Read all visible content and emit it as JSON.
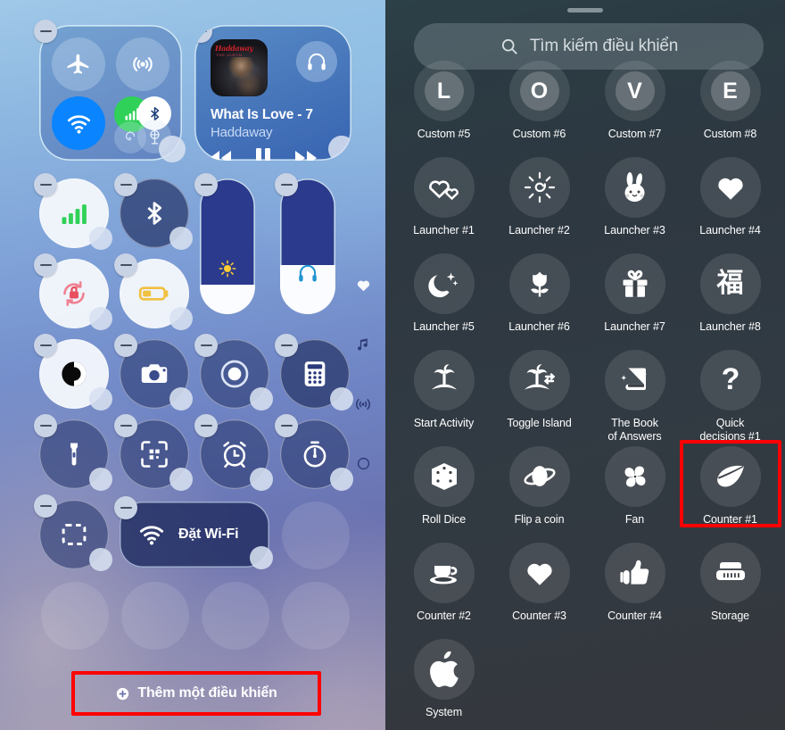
{
  "left_panel": {
    "name": "control-center-edit-mode",
    "connectivity_group": {
      "controls": [
        {
          "name": "airplane-mode",
          "icon": "airplane-icon",
          "state": "off"
        },
        {
          "name": "airdrop",
          "icon": "airdrop-icon",
          "state": "off"
        },
        {
          "name": "wifi",
          "icon": "wifi-icon",
          "state": "on",
          "color": "#0a84ff"
        },
        {
          "name": "cellular-data",
          "icon": "cellular-icon",
          "state": "on",
          "color": "#30d158"
        },
        {
          "name": "bluetooth",
          "icon": "bluetooth-icon",
          "state": "on",
          "color": "#ffffff"
        },
        {
          "name": "personal-hotspot",
          "icon": "hotspot-icon",
          "state": "off"
        },
        {
          "name": "vpn",
          "icon": "vpn-icon",
          "state": "off"
        }
      ]
    },
    "media_player": {
      "track_title": "What Is Love - 7",
      "artist": "Haddaway",
      "album_art_text": "Haddaway",
      "album_art_subtext": "THE ALBUM",
      "buttons": [
        "rewind",
        "pause",
        "fast-forward"
      ],
      "output_icon": "headphones-icon"
    },
    "tiles": [
      {
        "name": "cellular-signal",
        "icon": "signal-bars-icon",
        "style": "light"
      },
      {
        "name": "bluetooth-toggle",
        "icon": "bluetooth-icon",
        "style": "dark"
      },
      {
        "name": "rotation-lock",
        "icon": "rotation-lock-icon",
        "style": "light"
      },
      {
        "name": "low-power-mode",
        "icon": "battery-icon",
        "style": "light"
      },
      {
        "name": "dark-mode",
        "icon": "contrast-icon",
        "style": "light"
      },
      {
        "name": "camera",
        "icon": "camera-icon",
        "style": "dark"
      },
      {
        "name": "screen-record",
        "icon": "record-icon",
        "style": "dark"
      },
      {
        "name": "calculator",
        "icon": "calculator-icon",
        "style": "dark"
      },
      {
        "name": "flashlight",
        "icon": "flashlight-icon",
        "style": "dark"
      },
      {
        "name": "code-scanner",
        "icon": "qr-scanner-icon",
        "style": "dark"
      },
      {
        "name": "alarm",
        "icon": "alarm-clock-icon",
        "style": "dark"
      },
      {
        "name": "timer",
        "icon": "timer-icon",
        "style": "dark"
      },
      {
        "name": "screen-mirroring",
        "icon": "screen-mirroring-icon",
        "style": "dark"
      }
    ],
    "sliders": [
      {
        "name": "brightness-slider",
        "icon": "sun-icon",
        "level_percent": 22
      },
      {
        "name": "volume-slider",
        "icon": "headphones-icon",
        "level_percent": 36
      }
    ],
    "wifi_tile": {
      "label": "Đặt Wi-Fi",
      "icon": "wifi-icon"
    },
    "page_indicators": [
      {
        "name": "favorites-page",
        "icon": "heart-icon",
        "active": true
      },
      {
        "name": "media-page",
        "icon": "music-note-icon",
        "active": false
      },
      {
        "name": "connectivity-page",
        "icon": "broadcast-icon",
        "active": false
      },
      {
        "name": "other-page",
        "icon": "circle-icon",
        "active": false
      }
    ],
    "add_control_button": {
      "label": "Thêm một điều khiển",
      "icon": "plus-circle-icon"
    },
    "annotation_color": "#ff0000"
  },
  "right_panel": {
    "name": "control-gallery",
    "grabber": true,
    "search": {
      "placeholder": "Tìm kiếm điều khiển",
      "value": "",
      "icon": "search-icon"
    },
    "highlight": {
      "target": "Counter #1",
      "color": "#ff0000"
    },
    "rows": [
      [
        {
          "label": "Custom #5",
          "icon": "letter-L",
          "glyph": "L",
          "type": "letter"
        },
        {
          "label": "Custom #6",
          "icon": "letter-O",
          "glyph": "O",
          "type": "letter"
        },
        {
          "label": "Custom #7",
          "icon": "letter-V",
          "glyph": "V",
          "type": "letter"
        },
        {
          "label": "Custom #8",
          "icon": "letter-E",
          "glyph": "E",
          "type": "letter"
        }
      ],
      [
        {
          "label": "Launcher #1",
          "icon": "two-hearts-icon"
        },
        {
          "label": "Launcher #2",
          "icon": "sun-spiral-icon"
        },
        {
          "label": "Launcher #3",
          "icon": "bunny-icon"
        },
        {
          "label": "Launcher #4",
          "icon": "heart-icon"
        }
      ],
      [
        {
          "label": "Launcher #5",
          "icon": "moon-stars-icon"
        },
        {
          "label": "Launcher #6",
          "icon": "tulip-icon"
        },
        {
          "label": "Launcher #7",
          "icon": "gift-icon"
        },
        {
          "label": "Launcher #8",
          "icon": "fu-character-icon",
          "glyph": "福",
          "type": "cjk"
        }
      ],
      [
        {
          "label": "Start Activity",
          "icon": "palm-tree-icon"
        },
        {
          "label": "Toggle Island",
          "icon": "palm-tree-toggle-icon"
        },
        {
          "label": "The Book\nof Answers",
          "icon": "book-sparkle-icon"
        },
        {
          "label": "Quick\ndecisions #1",
          "icon": "question-mark-icon"
        }
      ],
      [
        {
          "label": "Roll Dice",
          "icon": "dice-icon"
        },
        {
          "label": "Flip a coin",
          "icon": "coin-orbit-icon"
        },
        {
          "label": "Fan",
          "icon": "fan-icon"
        },
        {
          "label": "Counter #1",
          "icon": "leaf-icon",
          "highlighted": true
        }
      ],
      [
        {
          "label": "Counter #2",
          "icon": "coffee-cup-icon"
        },
        {
          "label": "Counter #3",
          "icon": "heart-icon"
        },
        {
          "label": "Counter #4",
          "icon": "thumbs-up-icon"
        },
        {
          "label": "Storage",
          "icon": "storage-icon"
        }
      ],
      [
        {
          "label": "System",
          "icon": "apple-logo-icon"
        }
      ]
    ]
  }
}
